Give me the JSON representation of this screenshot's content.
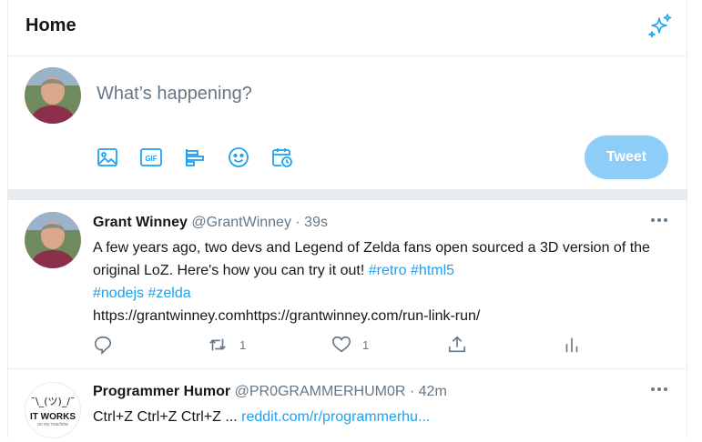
{
  "header": {
    "title": "Home",
    "icon": "sparkle-icon"
  },
  "compose": {
    "placeholder": "What’s happening?",
    "tools": [
      "image-icon",
      "gif-icon",
      "poll-icon",
      "emoji-icon",
      "schedule-icon"
    ],
    "gif_label": "GIF",
    "tweet_button": "Tweet"
  },
  "tweets": [
    {
      "name": "Grant Winney",
      "handle": "@GrantWinney",
      "sep": "·",
      "time": "39s",
      "text_a": "A few years ago, two devs and Legend of Zelda fans open sourced a 3D version of the original LoZ. Here's how you can try it out!",
      "hashtags_line1": [
        "#retro",
        "#html5"
      ],
      "hashtags_line2": [
        "#nodejs",
        "#zelda"
      ],
      "url_text": "https://grantwinney.comhttps://grantwinney.com/run-link-run/",
      "actions": {
        "reply_count": "",
        "retweet_count": "1",
        "like_count": "1"
      }
    },
    {
      "name": "Programmer Humor",
      "handle": "@PR0GRAMMERHUM0R",
      "sep": "·",
      "time": "42m",
      "text": "Ctrl+Z Ctrl+Z Ctrl+Z ...",
      "link": "reddit.com/r/programmerhu...",
      "avatar_shrug": "¯\\_(ツ)_/¯",
      "avatar_text": "IT WORKS",
      "avatar_sub": "on my machine"
    }
  ],
  "colors": {
    "accent": "#1da1f2",
    "button_disabled": "#8ecdf8",
    "muted": "#657786",
    "border": "#e6ecf0"
  }
}
